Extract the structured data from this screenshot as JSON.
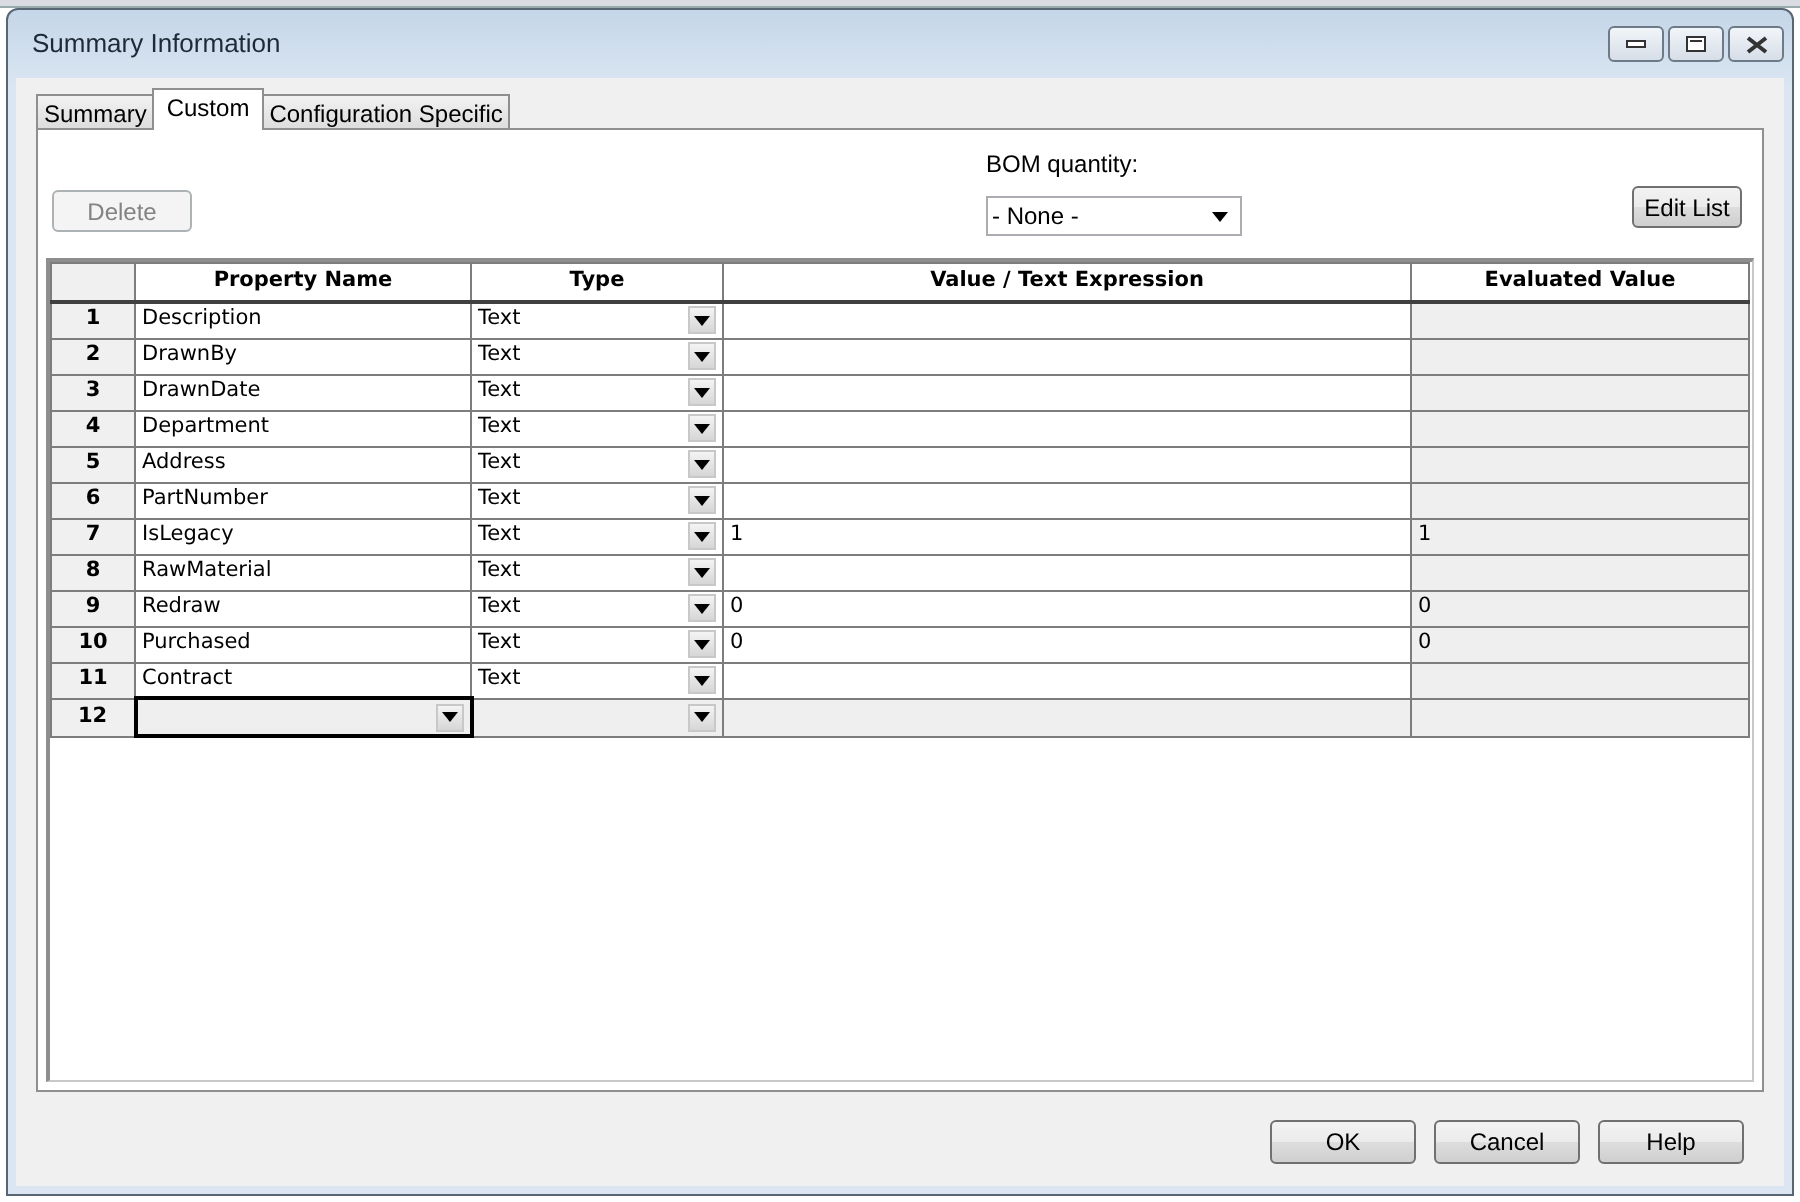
{
  "window": {
    "title": "Summary Information"
  },
  "tabs": [
    {
      "label": "Summary",
      "selected": false
    },
    {
      "label": "Custom",
      "selected": true
    },
    {
      "label": "Configuration Specific",
      "selected": false
    }
  ],
  "delete_button": {
    "label": "Delete",
    "disabled": true
  },
  "bom_quantity": {
    "label": "BOM quantity:",
    "value": "- None -"
  },
  "edit_list_button": {
    "label": "Edit List"
  },
  "table": {
    "columns": [
      "Property Name",
      "Type",
      "Value / Text Expression",
      "Evaluated Value"
    ],
    "rows": [
      {
        "number": "1",
        "property_name": "Description",
        "type": "Text",
        "value": "",
        "evaluated_value": "",
        "kind": "filled"
      },
      {
        "number": "2",
        "property_name": "DrawnBy",
        "type": "Text",
        "value": "",
        "evaluated_value": "",
        "kind": "filled"
      },
      {
        "number": "3",
        "property_name": "DrawnDate",
        "type": "Text",
        "value": "",
        "evaluated_value": "",
        "kind": "filled"
      },
      {
        "number": "4",
        "property_name": "Department",
        "type": "Text",
        "value": "",
        "evaluated_value": "",
        "kind": "filled"
      },
      {
        "number": "5",
        "property_name": "Address",
        "type": "Text",
        "value": "",
        "evaluated_value": "",
        "kind": "filled"
      },
      {
        "number": "6",
        "property_name": "PartNumber",
        "type": "Text",
        "value": "",
        "evaluated_value": "",
        "kind": "filled"
      },
      {
        "number": "7",
        "property_name": "IsLegacy",
        "type": "Text",
        "value": "1",
        "evaluated_value": "1",
        "kind": "filled"
      },
      {
        "number": "8",
        "property_name": "RawMaterial",
        "type": "Text",
        "value": "",
        "evaluated_value": "",
        "kind": "filled"
      },
      {
        "number": "9",
        "property_name": "Redraw",
        "type": "Text",
        "value": "0",
        "evaluated_value": "0",
        "kind": "filled"
      },
      {
        "number": "10",
        "property_name": "Purchased",
        "type": "Text",
        "value": "0",
        "evaluated_value": "0",
        "kind": "filled"
      },
      {
        "number": "11",
        "property_name": "Contract",
        "type": "Text",
        "value": "",
        "evaluated_value": "",
        "kind": "filled"
      },
      {
        "number": "12",
        "kind": "new"
      }
    ]
  },
  "footer_buttons": [
    "OK",
    "Cancel",
    "Help"
  ]
}
